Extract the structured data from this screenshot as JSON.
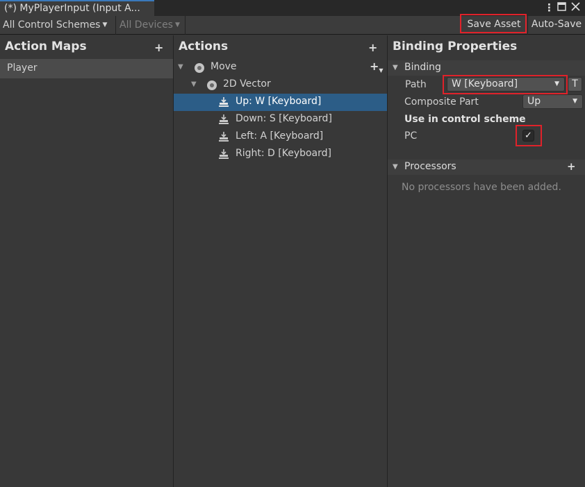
{
  "window": {
    "tab_title": "(*) MyPlayerInput (Input A...",
    "more_icon": "vertical-ellipsis",
    "maximize_icon": "maximize",
    "close_icon": "close"
  },
  "toolbar": {
    "control_schemes": "All Control Schemes",
    "devices": "All Devices",
    "save_asset": "Save Asset",
    "auto_save": "Auto-Save"
  },
  "action_maps": {
    "header": "Action Maps",
    "add": "+",
    "items": [
      {
        "label": "Player",
        "selected": true
      }
    ]
  },
  "actions": {
    "header": "Actions",
    "add": "+",
    "tree": [
      {
        "label": "Move",
        "type": "action",
        "expanded": true
      },
      {
        "label": "2D Vector",
        "type": "composite",
        "expanded": true
      },
      {
        "label": "Up: W [Keyboard]",
        "type": "binding",
        "selected": true
      },
      {
        "label": "Down: S [Keyboard]",
        "type": "binding"
      },
      {
        "label": "Left: A [Keyboard]",
        "type": "binding"
      },
      {
        "label": "Right: D [Keyboard]",
        "type": "binding"
      }
    ]
  },
  "binding_properties": {
    "header": "Binding Properties",
    "binding_section": "Binding",
    "path_label": "Path",
    "path_value": "W [Keyboard]",
    "t_button": "T",
    "composite_part_label": "Composite Part",
    "composite_part_value": "Up",
    "use_in_scheme_label": "Use in control scheme",
    "scheme_pc_label": "PC",
    "scheme_pc_checked": true,
    "processors_section": "Processors",
    "processors_add": "+",
    "processors_empty": "No processors have been added."
  },
  "colors": {
    "selection": "#2c5d87",
    "highlight": "#e0222a",
    "tab_accent": "#3a79bb"
  }
}
